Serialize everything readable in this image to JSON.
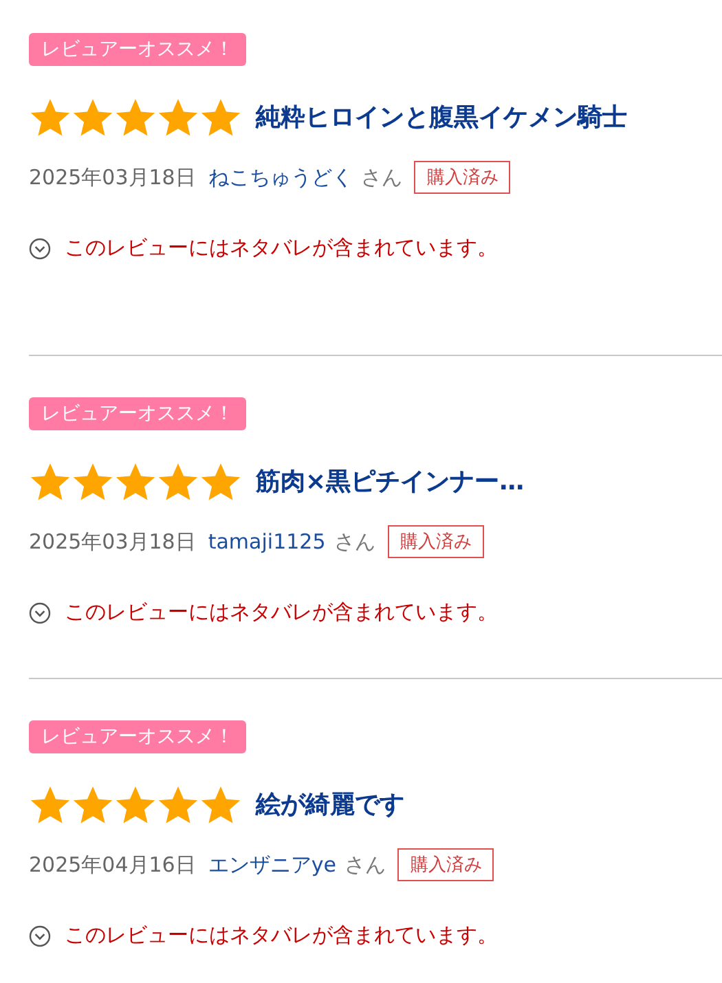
{
  "reviews": [
    {
      "badge": "レビュアーオススメ！",
      "stars": 5,
      "title": "純粋ヒロインと腹黒イケメン騎士",
      "date": "2025年03月18日",
      "reviewer": "ねこちゅうどく",
      "honorific": "さん",
      "purchased_label": "購入済み",
      "spoiler": "このレビューにはネタバレが含まれています。"
    },
    {
      "badge": "レビュアーオススメ！",
      "stars": 5,
      "title": "筋肉×黒ピチインナー…",
      "date": "2025年03月18日",
      "reviewer": "tamaji1125",
      "honorific": "さん",
      "purchased_label": "購入済み",
      "spoiler": "このレビューにはネタバレが含まれています。"
    },
    {
      "badge": "レビュアーオススメ！",
      "stars": 5,
      "title": "絵が綺麗です",
      "date": "2025年04月16日",
      "reviewer": "エンザニアye",
      "honorific": "さん",
      "purchased_label": "購入済み",
      "spoiler": "このレビューにはネタバレが含まれています。"
    }
  ]
}
